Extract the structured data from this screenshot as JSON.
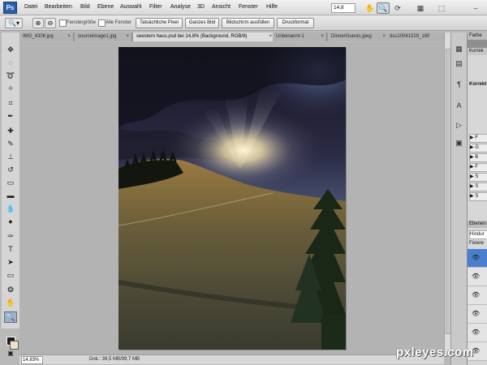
{
  "menubar": {
    "logo": "Ps",
    "items": [
      "Datei",
      "Bearbeiten",
      "Bild",
      "Ebene",
      "Auswahl",
      "Filter",
      "Analyse",
      "3D",
      "Ansicht",
      "Fenster",
      "Hilfe"
    ],
    "zoom": "14,8",
    "icons": [
      "hand-icon",
      "zoom-icon",
      "rotate-view-icon",
      "grid-icon",
      "arrange-documents-icon",
      "screen-mode-icon"
    ]
  },
  "options": {
    "resize_windows": "Fenstergröße",
    "all_windows": "Alle Fenster",
    "buttons": [
      "Tatsächliche Pixel",
      "Ganzes Bild",
      "Bildschirm ausfüllen",
      "Druckformat"
    ]
  },
  "tabs": [
    {
      "label": "IMG_4308.jpg"
    },
    {
      "label": "sourceimage1.jpg"
    },
    {
      "label": "seestern haus.psd bei 14,8% (Background, RGB/8)"
    },
    {
      "label": "Unbenannt-1"
    },
    {
      "label": "DinnerGuests.jpeg"
    },
    {
      "label": "dsc20041029_180"
    }
  ],
  "close_glyph": "×",
  "status": {
    "zoom": "14,83%",
    "doc": "Dok.: 39,5 MB/99,7 MB"
  },
  "panels": {
    "color_header": "Farbe",
    "corrections_header": "Korrek",
    "corrections_title": "Korrekt",
    "presets": [
      "▶ F",
      "▶ G",
      "▶ B",
      "▶ F",
      "▶ S",
      "▶ S",
      "▶ S"
    ],
    "layers_header": "Ebenen",
    "blend_mode": "Hindur",
    "lock_label": "Fixiere"
  },
  "watermark": "pxleyes.com",
  "colors": {
    "selected_layer": "#4a7fd0",
    "active_tab": "#dcdcdc"
  }
}
